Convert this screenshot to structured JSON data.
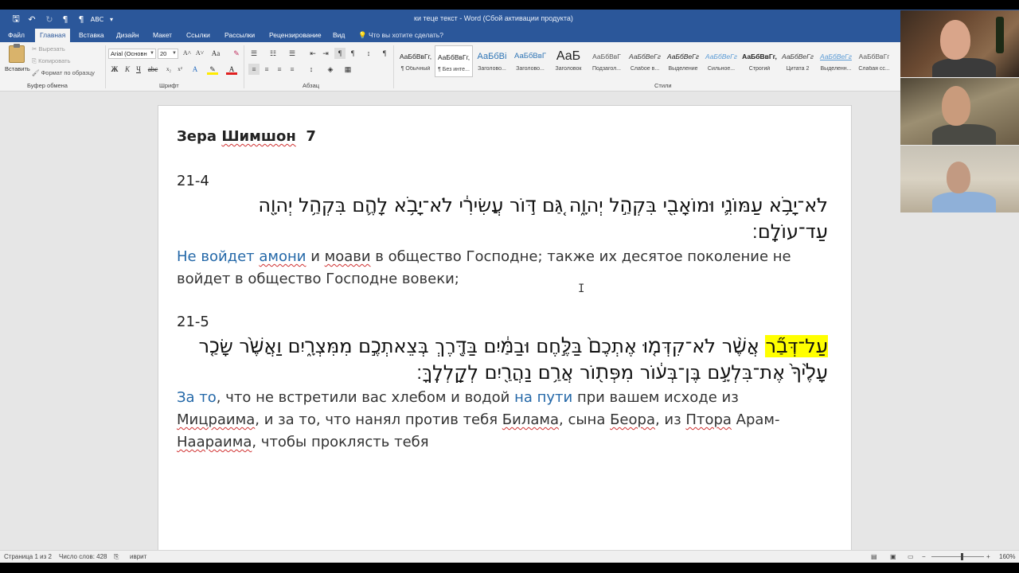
{
  "window": {
    "title": "ки теце текст - Word (Сбой активации продукта)"
  },
  "tabs": [
    "Файл",
    "Главная",
    "Вставка",
    "Дизайн",
    "Макет",
    "Ссылки",
    "Рассылки",
    "Рецензирование",
    "Вид"
  ],
  "tell_me": "Что вы хотите сделать?",
  "ribbon": {
    "clipboard": {
      "paste": "Вставить",
      "cut": "Вырезать",
      "copy": "Копировать",
      "format_painter": "Формат по образцу",
      "label": "Буфер обмена"
    },
    "font": {
      "name": "Arial (Основн",
      "size": "20",
      "label": "Шрифт"
    },
    "paragraph": {
      "label": "Абзац"
    },
    "styles": {
      "label": "Стили",
      "items": [
        {
          "sample": "АаБбВвГг,",
          "name": "¶ Обычный"
        },
        {
          "sample": "АаБбВвГг,",
          "name": "¶ Без инте..."
        },
        {
          "sample": "АаБбВі",
          "name": "Заголово..."
        },
        {
          "sample": "АаБбВвГ",
          "name": "Заголово..."
        },
        {
          "sample": "АаБ",
          "name": "Заголовок"
        },
        {
          "sample": "АаБбВвГ",
          "name": "Подзагол..."
        },
        {
          "sample": "АаБбВеГг",
          "name": "Слабое в..."
        },
        {
          "sample": "АаБбВеГг",
          "name": "Выделение"
        },
        {
          "sample": "АаБбВеГг",
          "name": "Сильное..."
        },
        {
          "sample": "АаБбВвГг,",
          "name": "Строгий"
        },
        {
          "sample": "АаБбВеГг",
          "name": "Цитата 2"
        },
        {
          "sample": "АаБбВеГг",
          "name": "Выделенн..."
        },
        {
          "sample": "АаБбВвГг",
          "name": "Слабая сс..."
        }
      ]
    }
  },
  "document": {
    "heading_part1": "Зера",
    "heading_part2": "Шимшон",
    "heading_part3": "7",
    "verse1": {
      "ref": "21-4",
      "hebrew": "לֹא־יָבֹ֥א עַמּוֹנִ֛י וּמוֹאָבִ֖י בִּקְהַ֣ל יְהוָ֑ה גַּ֚ם דּ֣וֹר עֲשִׂירִ֔י לֹא־יָבֹ֥א לָהֶ֛ם בִּקְהַ֥ל יְהוָ֖ה עַד־עוֹלָֽם׃",
      "ru_blue1": "Не войдет",
      "ru_blue2": "амони",
      "ru_and": " и ",
      "ru_moavi": "моави",
      "ru_rest": " в общество Господне; также их десятое поколение не войдет в общество Господне вовеки;"
    },
    "verse2": {
      "ref": "21-5",
      "hebrew_hl": "עַל־דְּבַ֞ר",
      "hebrew_rest": " אֲשֶׁ֨ר לֹא־קִדְּמ֤וּ אֶתְכֶם֙ בַּלֶּ֣חֶם וּבַמַּ֔יִם בַּדֶּ֖רֶךְ בְּצֵאתְכֶ֣ם מִמִּצְרָ֑יִם וַאֲשֶׁ֙ר שָׂכַ֤ר עָלֶ֙יךָ֙ אֶת־בִּלְעָ֣ם בֶּן־בְּע֔וֹר מִפְּת֖וֹר אֲרַ֥ם נַהֲרַ֖יִם לְקַֽלְלֶֽךָּ׃",
      "ru_blue1": "За то",
      "ru_p1": ", что не встретили вас хлебом и водой ",
      "ru_blue2": "на пути",
      "ru_p2": " при вашем исходе из ",
      "ru_sq1": "Мицраима",
      "ru_p3": ", и за то, что нанял против тебя ",
      "ru_sq2": "Билама",
      "ru_p4": ", сына ",
      "ru_sq3": "Беора",
      "ru_p5": ", из ",
      "ru_sq4": "Птора",
      "ru_p6": " Арам-",
      "ru_sq5": "Наараима",
      "ru_p7": ", чтобы проклясть тебя"
    }
  },
  "status": {
    "page": "Страница 1 из 2",
    "words": "Число слов: 428",
    "lang": "иврит",
    "zoom": "160%"
  }
}
